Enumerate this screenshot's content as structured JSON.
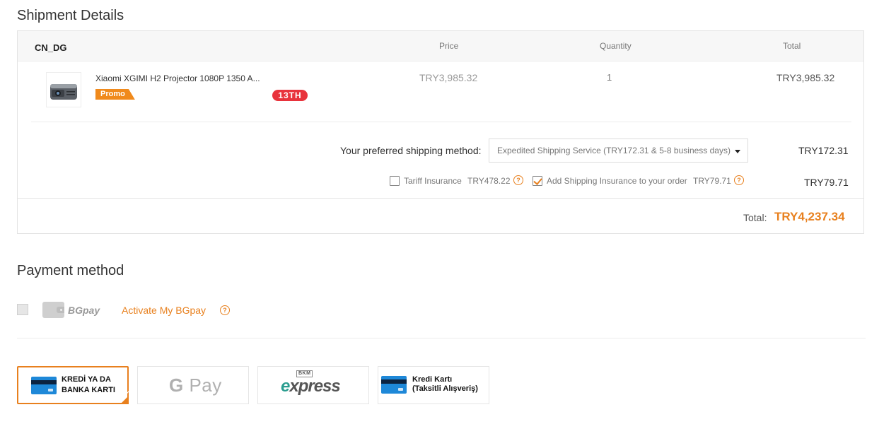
{
  "shipment": {
    "title": "Shipment Details",
    "store": "CN_DG",
    "columns": {
      "price": "Price",
      "quantity": "Quantity",
      "total": "Total"
    },
    "item": {
      "name": "Xiaomi XGIMI H2 Projector 1080P 1350 A...",
      "promo": "Promo",
      "anniversary_badge": "13TH",
      "price": "TRY3,985.32",
      "quantity": "1",
      "total": "TRY3,985.32"
    },
    "shipping": {
      "label": "Your preferred shipping method:",
      "selected": "Expedited Shipping Service (TRY172.31 & 5-8 business days)",
      "cost": "TRY172.31"
    },
    "insurance": {
      "tariff_label": "Tariff Insurance",
      "tariff_price": "TRY478.22",
      "tariff_checked": false,
      "shipping_ins_label": "Add Shipping Insurance to your order",
      "shipping_ins_price": "TRY79.71",
      "shipping_ins_checked": true,
      "cost": "TRY79.71"
    },
    "total_label": "Total:",
    "total_value": "TRY4,237.34"
  },
  "payment": {
    "title": "Payment method",
    "bgpay_brand": "BGpay",
    "bgpay_activate": "Activate My BGpay",
    "help_glyph": "?",
    "options": [
      {
        "line1": "KREDİ YA DA",
        "line2": "BANKA KARTI",
        "selected": true
      },
      {
        "label": "G Pay",
        "label_g": "G",
        "label_pay": "Pay"
      },
      {
        "bkm_top": "BKM",
        "label_e": "e",
        "label_xpress": "xpress"
      },
      {
        "line1": "Kredi Kartı",
        "line2": "(Taksitli Alışveriş)"
      }
    ]
  },
  "colors": {
    "accent": "#e8801e",
    "badge_red": "#e8333c",
    "card_blue": "#1e88d8"
  },
  "icons": [
    "projector-thumbnail",
    "help-icon",
    "wallet-icon",
    "credit-card-icon",
    "chevron-down-icon",
    "check-icon"
  ]
}
